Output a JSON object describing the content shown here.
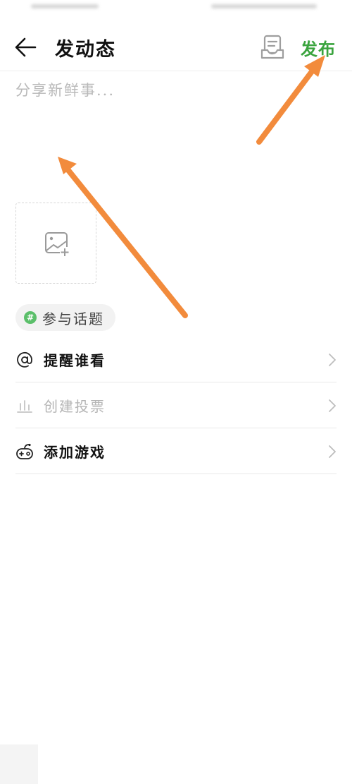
{
  "header": {
    "title": "发动态",
    "publish_label": "发布"
  },
  "composer": {
    "placeholder": "分享新鲜事..."
  },
  "topic": {
    "hash_glyph": "#",
    "label": "参与话题"
  },
  "options": [
    {
      "label": "提醒谁看",
      "icon": "at-icon",
      "enabled": true
    },
    {
      "label": "创建投票",
      "icon": "poll-icon",
      "enabled": false
    },
    {
      "label": "添加游戏",
      "icon": "gamepad-icon",
      "enabled": true
    }
  ],
  "colors": {
    "accent_green": "#3aa43e",
    "annotation_orange": "#f28b3c",
    "placeholder_gray": "#b9b9b9"
  }
}
